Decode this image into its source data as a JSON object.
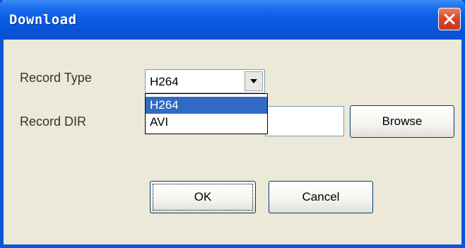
{
  "window": {
    "title": "Download",
    "close_icon": "close-icon"
  },
  "form": {
    "record_type_label": "Record Type",
    "record_type_value": "H264",
    "record_type_options": [
      "H264",
      "AVI"
    ],
    "record_type_selected_option": "H264",
    "record_dir_label": "Record DIR",
    "record_dir_value": ""
  },
  "buttons": {
    "browse_label": "Browse",
    "ok_label": "OK",
    "cancel_label": "Cancel"
  },
  "colors": {
    "titlebar": "#0a5ee6",
    "dialog_background": "#ece9d8",
    "selection_highlight": "#316ac5",
    "close_button": "#d9482a"
  }
}
